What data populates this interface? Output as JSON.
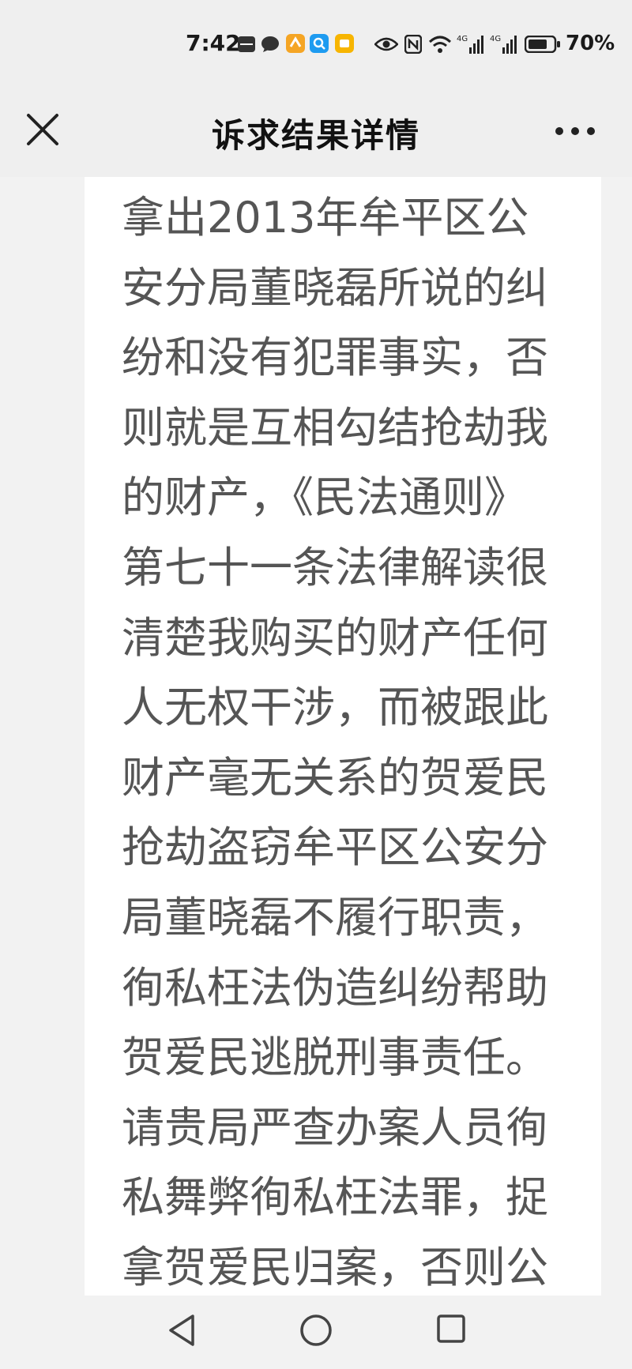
{
  "status_bar": {
    "time": "7:42",
    "battery_percent": "70%",
    "icons": [
      "hiapp-icon",
      "chat-bubble-icon",
      "orange-app-icon",
      "blue-search-app-icon",
      "yellow-app-icon",
      "eye-icon",
      "nfc-icon",
      "wifi-icon",
      "signal-4g-icon",
      "signal-4g-icon",
      "battery-icon"
    ]
  },
  "header": {
    "title": "诉求结果详情",
    "close_icon": "close-icon",
    "more_icon": "more-icon"
  },
  "content": {
    "body_text": "拿出2013年牟平区公安分局董晓磊所说的纠纷和没有犯罪事实，否则就是互相勾结抢劫我的财产，《民法通则》第七十一条法律解读很清楚我购买的财产任何人无权干涉，而被跟此财产毫无关系的贺爱民抢劫盗窃牟平区公安分局董晓磊不履行职责，徇私枉法伪造纠纷帮助贺爱民逃脱刑事责任。请贵局严查办案人员徇私舞弊徇私枉法罪，捉拿贺爱民归案，否则公示"
  },
  "system_nav": {
    "back_icon": "back-triangle-icon",
    "home_icon": "home-circle-icon",
    "recents_icon": "recents-square-icon"
  }
}
